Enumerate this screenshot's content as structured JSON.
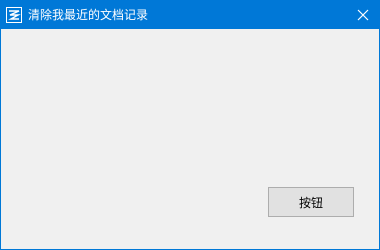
{
  "window": {
    "title": "清除我最近的文档记录",
    "app_icon": "app-logo-icon",
    "close_icon": "close-icon"
  },
  "main": {
    "button_label": "按钮"
  },
  "colors": {
    "titlebar": "#0078d7",
    "client_background": "#f0f0f0",
    "button_background": "#e1e1e1",
    "button_border": "#adadad"
  }
}
